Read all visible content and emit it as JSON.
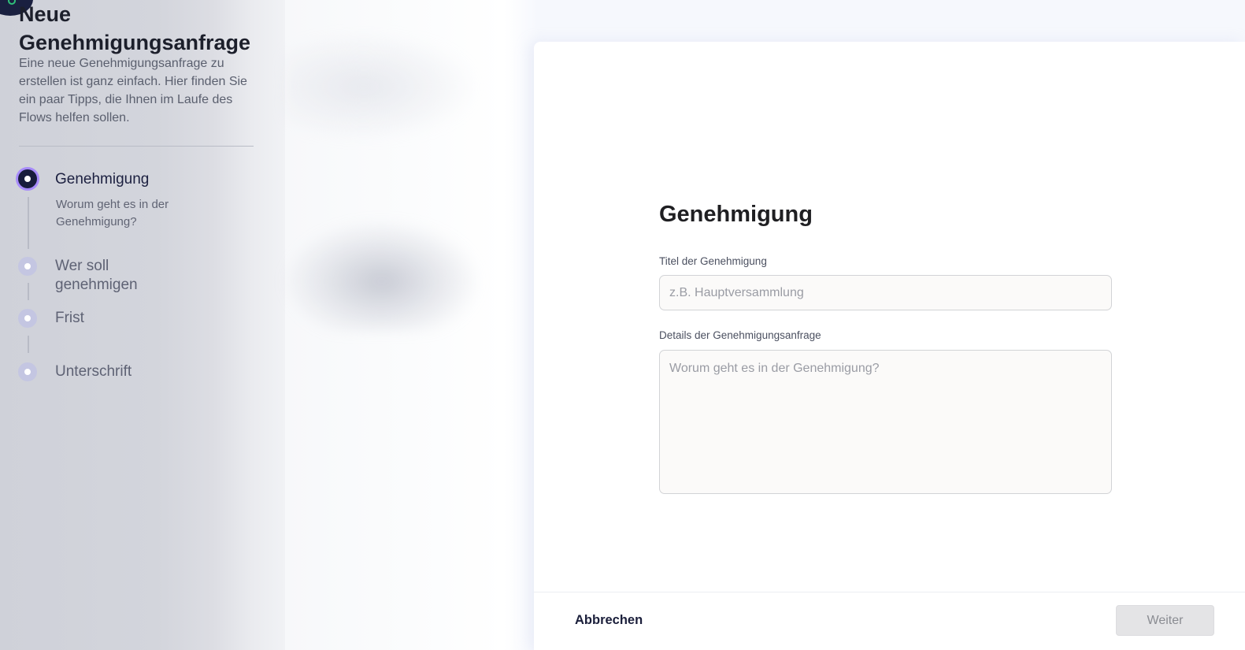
{
  "sidebar": {
    "title": "Neue Genehmigungsanfrage",
    "intro": "Eine neue Genehmigungsanfrage zu erstellen ist ganz einfach. Hier finden Sie ein paar Tipps, die Ihnen im Laufe des Flows helfen sollen.",
    "steps": [
      {
        "label": "Genehmigung",
        "description": "Worum geht es in der Genehmigung?",
        "active": true
      },
      {
        "label": "Wer soll genehmigen",
        "active": false
      },
      {
        "label": "Frist",
        "active": false
      },
      {
        "label": "Unterschrift",
        "active": false
      }
    ]
  },
  "form": {
    "title": "Genehmigung",
    "title_field": {
      "label": "Titel der Genehmigung",
      "placeholder": "z.B. Hauptversammlung",
      "value": ""
    },
    "details_field": {
      "label": "Details der Genehmigungsanfrage",
      "placeholder": "Worum geht es in der Genehmigung?",
      "value": ""
    }
  },
  "footer": {
    "cancel_label": "Abbrechen",
    "next_label": "Weiter"
  },
  "colors": {
    "accent": "#181c3c",
    "active_ring": "#a78bfa",
    "inactive_step": "#c4c6e2",
    "status_online": "#2fc07a"
  },
  "icons": {
    "avatar": "user-avatar-icon"
  }
}
